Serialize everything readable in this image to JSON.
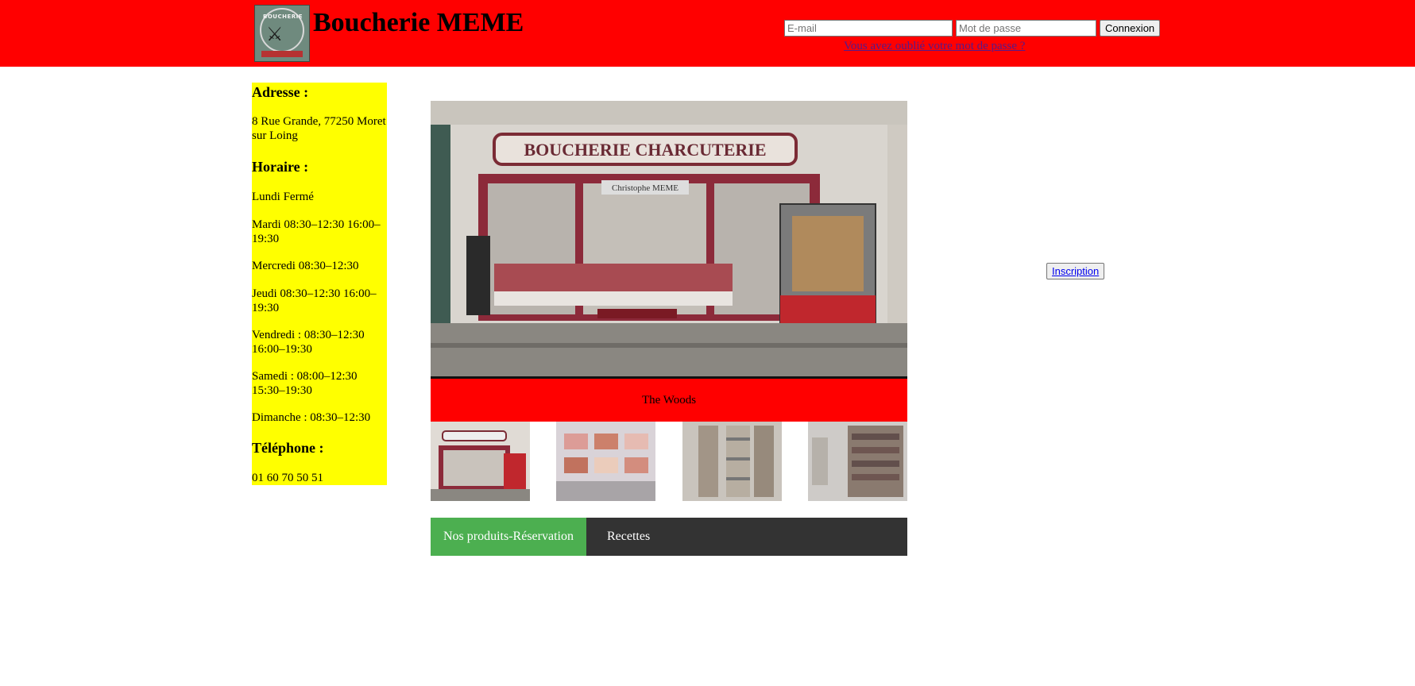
{
  "header": {
    "logo_text": "BOUCHERIE",
    "title": "Boucherie MEME",
    "email_placeholder": "E-mail",
    "password_placeholder": "Mot de passe",
    "login_label": "Connexion",
    "forgot_link": "Vous avez oublié votre mot de passe ?"
  },
  "sidebar": {
    "address_heading": "Adresse :",
    "address": "8 Rue Grande, 77250 Moret sur Loing",
    "hours_heading": "Horaire :",
    "hours": [
      "Lundi Fermé",
      "Mardi 08:30–12:30 16:00–19:30",
      "Mercredi 08:30–12:30",
      "Jeudi 08:30–12:30 16:00–19:30",
      "Vendredi : 08:30–12:30 16:00–19:30",
      "Samedi : 08:00–12:30 15:30–19:30",
      "Dimanche : 08:30–12:30"
    ],
    "phone_heading": "Téléphone :",
    "phone": "01 60 70 50 51"
  },
  "slideshow": {
    "sign_text": "BOUCHERIE CHARCUTERIE",
    "door_text": "Christophe MEME",
    "caption": "The Woods",
    "thumbnails": [
      "shop-front",
      "meat-counter",
      "grocery-shelf",
      "wine-shelf"
    ],
    "active_thumbnail": 1
  },
  "nav": {
    "items": [
      "Nos produits-Réservation",
      "Recettes"
    ]
  },
  "signup_label": "Inscription",
  "colors": {
    "header_bg": "#ff0000",
    "sidebar_bg": "#ffff00",
    "nav_bg": "#333333",
    "nav_active": "#4caf50"
  }
}
